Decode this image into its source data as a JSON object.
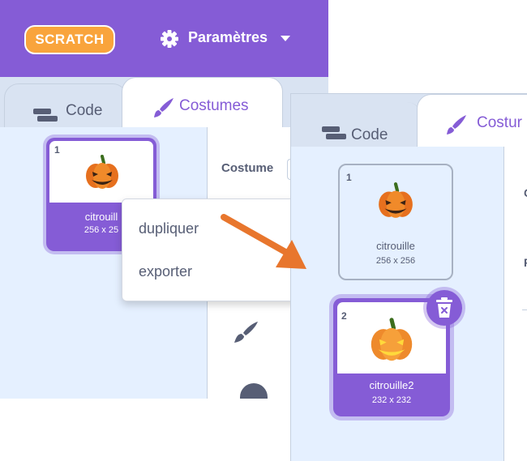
{
  "colors": {
    "accent": "#855cd6",
    "pane": "#e5f0ff",
    "text": "#575e75",
    "arrow": "#e8762d"
  },
  "left": {
    "logo_text": "SCRATCH",
    "menu": {
      "settings_label": "Paramètres"
    },
    "tabs": {
      "code": "Code",
      "costumes": "Costumes"
    },
    "editor": {
      "costume_label": "Costume"
    },
    "costume": {
      "number": "1",
      "name": "citrouill",
      "size": "256 x 25"
    },
    "context_menu": {
      "duplicate": "dupliquer",
      "export": "exporter"
    }
  },
  "right": {
    "tabs": {
      "code": "Code",
      "costumes": "Costur"
    },
    "editor": {
      "frag1": "C",
      "frag2": "F"
    },
    "costumes": [
      {
        "number": "1",
        "name": "citrouille",
        "size": "256 x 256"
      },
      {
        "number": "2",
        "name": "citrouille2",
        "size": "232 x 232"
      }
    ]
  },
  "icons": [
    "gear-icon",
    "code-blocks-icon",
    "paintbrush-icon",
    "pumpkin-icon",
    "trash-icon",
    "arrow-icon"
  ]
}
